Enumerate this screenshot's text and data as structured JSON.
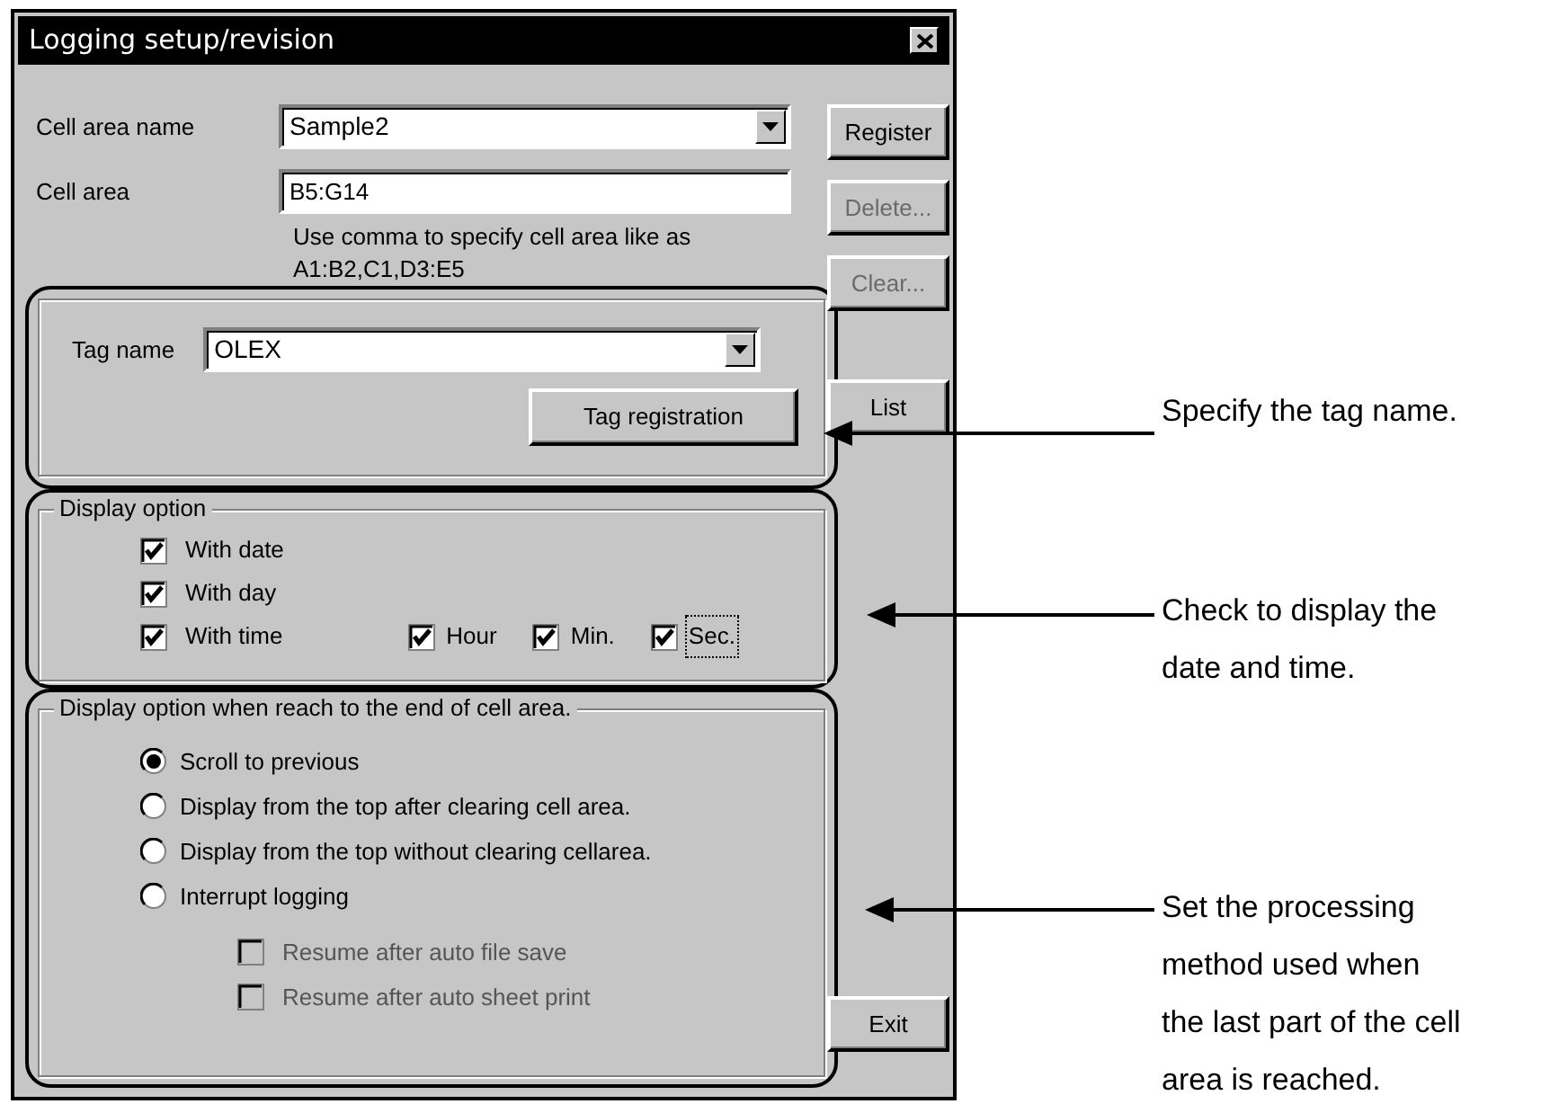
{
  "window": {
    "title": "Logging setup/revision"
  },
  "cell_area_name": {
    "label": "Cell area name",
    "value": "Sample2"
  },
  "cell_area": {
    "label": "Cell area",
    "value": "B5:G14"
  },
  "hint": "Use comma to specify cell area like as A1:B2,C1,D3:E5",
  "buttons": [
    {
      "label": "Register",
      "disabled": false
    },
    {
      "label": "Delete...",
      "disabled": true
    },
    {
      "label": "Clear...",
      "disabled": true
    },
    {
      "label": "List",
      "disabled": false
    },
    {
      "label": "Exit",
      "disabled": false
    }
  ],
  "tag": {
    "label": "Tag name",
    "value": "OLEX",
    "button": "Tag registration"
  },
  "display_option": {
    "title": "Display option",
    "checks": [
      {
        "label": "With date",
        "checked": true
      },
      {
        "label": "With day",
        "checked": true
      },
      {
        "label": "With time",
        "checked": true
      }
    ],
    "time_checks": [
      {
        "label": "Hour",
        "checked": true,
        "focused": false
      },
      {
        "label": "Min.",
        "checked": true,
        "focused": false
      },
      {
        "label": "Sec.",
        "checked": true,
        "focused": true
      }
    ]
  },
  "end_option": {
    "title": "Display option when reach to the end of cell area.",
    "radios": [
      {
        "label": "Scroll to previous",
        "selected": true
      },
      {
        "label": "Display from the top after clearing cell area.",
        "selected": false
      },
      {
        "label": "Display from the top without clearing cellarea.",
        "selected": false
      },
      {
        "label": "Interrupt logging",
        "selected": false
      }
    ],
    "sub_checks": [
      {
        "label": "Resume after auto file save",
        "checked": false,
        "disabled": true
      },
      {
        "label": "Resume after auto sheet print",
        "checked": false,
        "disabled": true
      }
    ]
  },
  "callouts": [
    {
      "lines": [
        "Specify the tag name."
      ]
    },
    {
      "lines": [
        "Check to display the",
        "date and time."
      ]
    },
    {
      "lines": [
        "Set the processing",
        "method used when",
        "the last part of the cell",
        "area is reached."
      ]
    }
  ]
}
